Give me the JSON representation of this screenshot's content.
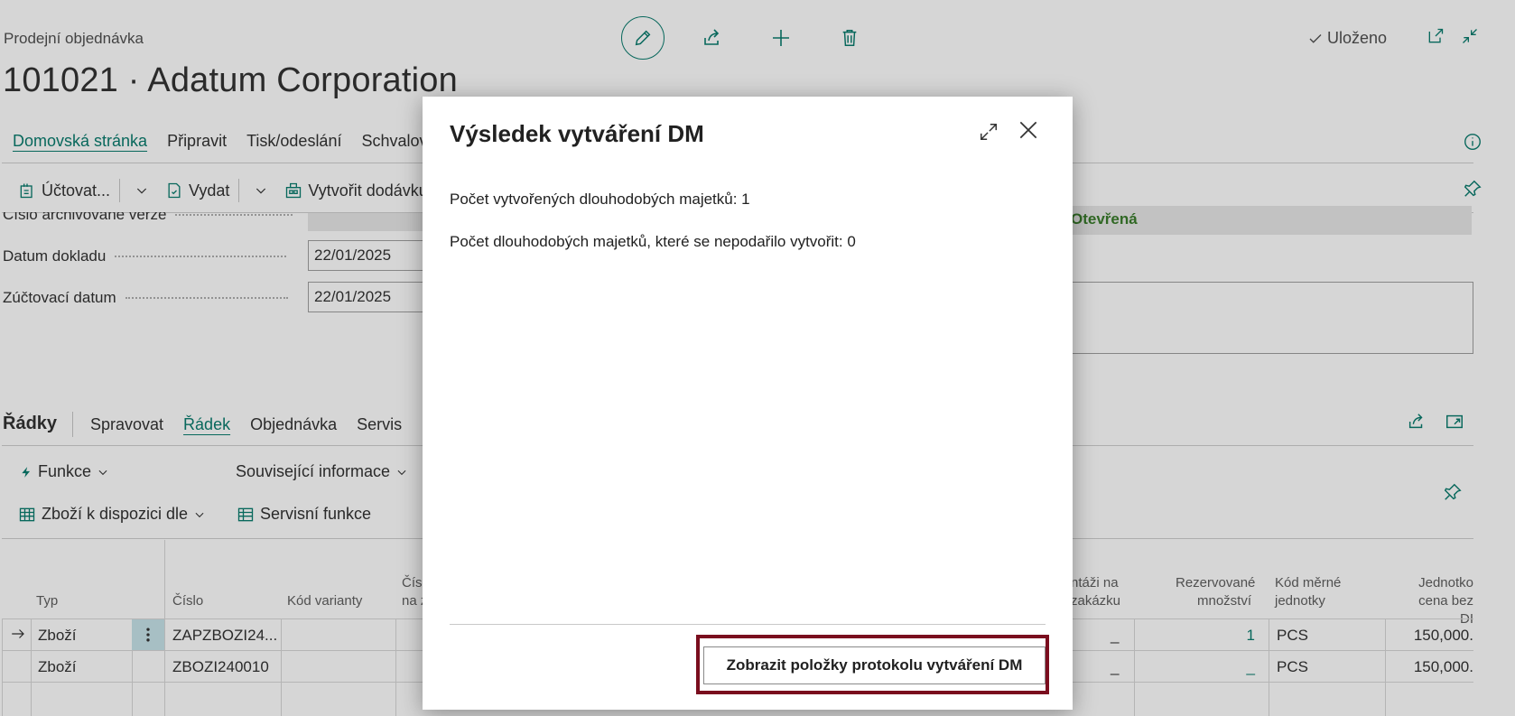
{
  "header": {
    "kind": "Prodejní objednávka",
    "title": "101021 · Adatum Corporation",
    "saved_status": "Uloženo"
  },
  "tabs": [
    "Domovská stránka",
    "Připravit",
    "Tisk/odeslání",
    "Schvalován"
  ],
  "toolbar": {
    "post_label": "Účtovat...",
    "release_label": "Vydat",
    "create_delivery_label": "Vytvořit dodávku"
  },
  "fields": {
    "archived_version_label": "Číslo archivované verze",
    "doc_date_label": "Datum dokladu",
    "doc_date_value": "22/01/2025",
    "posting_date_label": "Zúčtovací datum",
    "posting_date_value": "22/01/2025",
    "status_value": "Otevřená"
  },
  "lines": {
    "title": "Řádky",
    "tabs": [
      "Spravovat",
      "Řádek",
      "Objednávka",
      "Servis"
    ],
    "actions": {
      "functions": "Funkce",
      "related_info": "Související informace",
      "item_availability": "Zboží k dispozici dle",
      "service_functions": "Servisní funkce"
    },
    "columns": {
      "type": "Typ",
      "number": "Číslo",
      "variant": "Kód varianty",
      "num_partial_1": "Čísl",
      "num_partial_2": "na z",
      "assembly_1": "ntáži na",
      "assembly_2": "zakázku",
      "reserved_1": "Rezervované",
      "reserved_2": "množství",
      "uom_1": "Kód měrné",
      "uom_2": "jednotky",
      "price_1": "Jednotko",
      "price_2": "cena bez DI"
    },
    "rows": [
      {
        "type": "Zboží",
        "number": "ZAPZBOZI24...",
        "assembly": "_",
        "reserved": "1",
        "uom": "PCS",
        "price": "150,000."
      },
      {
        "type": "Zboží",
        "number": "ZBOZI240010",
        "assembly": "_",
        "reserved": "_",
        "uom": "PCS",
        "price": "150,000."
      }
    ]
  },
  "dialog": {
    "title": "Výsledek vytváření DM",
    "line1": "Počet vytvořených dlouhodobých majetků: 1",
    "line2": "Počet dlouhodobých majetků, které se nepodařilo vytvořit: 0",
    "button_label": "Zobrazit položky protokolu vytváření DM"
  },
  "colors": {
    "accent": "#0a7c6e",
    "status_green": "#3a7d2c",
    "highlight_border": "#7a0d1e"
  }
}
